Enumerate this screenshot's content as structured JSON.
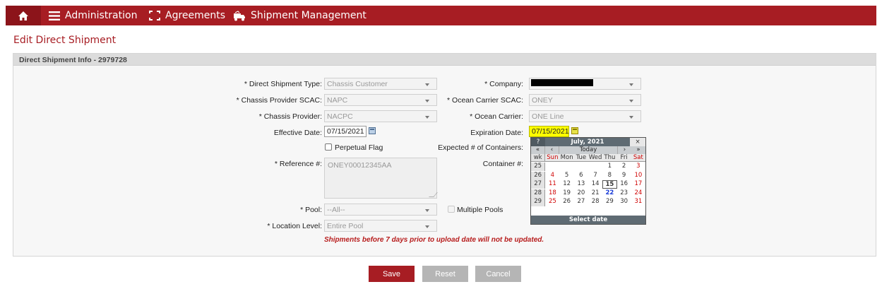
{
  "nav": {
    "items": [
      {
        "label": "Administration",
        "icon": "menu-icon"
      },
      {
        "label": "Agreements",
        "icon": "agreements-icon"
      },
      {
        "label": "Shipment Management",
        "icon": "truck-icon"
      }
    ],
    "color": "#a71d23"
  },
  "page": {
    "title": "Edit Direct Shipment"
  },
  "panel": {
    "title": "Direct Shipment Info - 2979728"
  },
  "form": {
    "shipment_type": {
      "label": "* Direct Shipment Type:",
      "value": "Chassis Customer"
    },
    "provider_scac": {
      "label": "* Chassis Provider SCAC:",
      "value": "NAPC"
    },
    "provider": {
      "label": "* Chassis Provider:",
      "value": "NACPC"
    },
    "effective_date": {
      "label": "Effective Date:",
      "value": "07/15/2021"
    },
    "perpetual_flag": {
      "label": "Perpetual Flag"
    },
    "reference": {
      "label": "* Reference #:",
      "value": "ONEY00012345AA"
    },
    "pool": {
      "label": "* Pool:",
      "value": "--All--"
    },
    "multiple_pools": {
      "label": "Multiple Pools"
    },
    "location_level": {
      "label": "* Location Level:",
      "value": "Entire Pool"
    },
    "company": {
      "label": "* Company:"
    },
    "ocean_scac": {
      "label": "* Ocean Carrier SCAC:",
      "value": "ONEY"
    },
    "ocean_carrier": {
      "label": "* Ocean Carrier:",
      "value": "ONE Line"
    },
    "expiration_date": {
      "label": "Expiration Date:",
      "value": "07/15/2021"
    },
    "expected_containers": {
      "label": "Expected # of Containers:"
    },
    "container": {
      "label": "Container #:"
    },
    "warning": "Shipments before 7 days prior to upload date will not be updated."
  },
  "buttons": {
    "save": "Save",
    "reset": "Reset",
    "cancel": "Cancel"
  },
  "calendar": {
    "help": "?",
    "title": "July, 2021",
    "close": "×",
    "prev_year": "«",
    "prev_month": "‹",
    "today": "Today",
    "next_month": "›",
    "next_year": "»",
    "days": [
      "wk",
      "Sun",
      "Mon",
      "Tue",
      "Wed",
      "Thu",
      "Fri",
      "Sat"
    ],
    "weeks": [
      [
        "25",
        "",
        "",
        "",
        "",
        "1",
        "2",
        "3"
      ],
      [
        "26",
        "4",
        "5",
        "6",
        "7",
        "8",
        "9",
        "10"
      ],
      [
        "27",
        "11",
        "12",
        "13",
        "14",
        "15",
        "16",
        "17"
      ],
      [
        "28",
        "18",
        "19",
        "20",
        "21",
        "22",
        "23",
        "24"
      ],
      [
        "29",
        "25",
        "26",
        "27",
        "28",
        "29",
        "30",
        "31"
      ]
    ],
    "footer": "Select date"
  }
}
